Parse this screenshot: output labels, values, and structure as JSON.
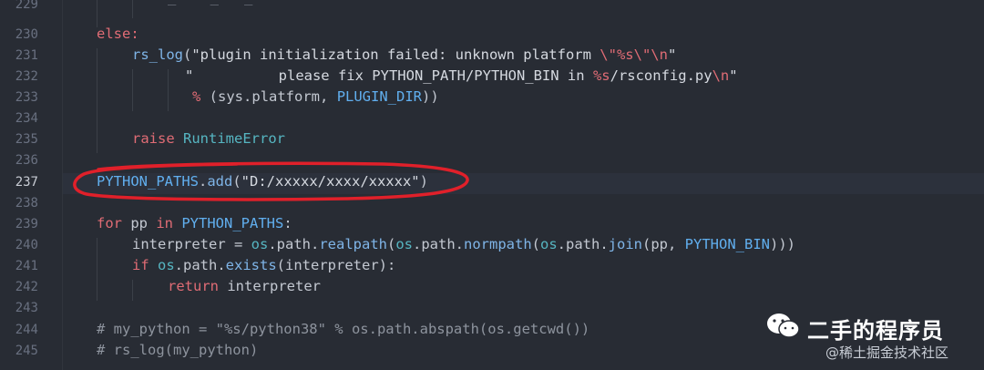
{
  "editor": {
    "lines": [
      {
        "n": "229",
        "active": false
      },
      {
        "n": "230",
        "active": false
      },
      {
        "n": "231",
        "active": false
      },
      {
        "n": "232",
        "active": false
      },
      {
        "n": "233",
        "active": false
      },
      {
        "n": "234",
        "active": false
      },
      {
        "n": "235",
        "active": false
      },
      {
        "n": "236",
        "active": false
      },
      {
        "n": "237",
        "active": true
      },
      {
        "n": "238",
        "active": false
      },
      {
        "n": "239",
        "active": false
      },
      {
        "n": "240",
        "active": false
      },
      {
        "n": "241",
        "active": false
      },
      {
        "n": "242",
        "active": false
      },
      {
        "n": "243",
        "active": false
      },
      {
        "n": "244",
        "active": false
      },
      {
        "n": "245",
        "active": false
      }
    ],
    "code": {
      "l230": {
        "else": "else:"
      },
      "l231": {
        "func": "rs_log",
        "open": "(",
        "str1": "\"plugin initialization failed: unknown platform ",
        "esc1": "\\\"",
        "fmt": "%s",
        "esc2": "\\\"",
        "esc3": "\\n",
        "str1end": "\""
      },
      "l232": {
        "str2": "\"          please fix PYTHON_PATH/PYTHON_BIN in ",
        "fmt": "%s",
        "str2b": "/rsconfig.py",
        "esc": "\\n",
        "str2end": "\""
      },
      "l233": {
        "pct": "%",
        "open": " (",
        "sys": "sys",
        "dot": ".",
        "platform": "platform",
        "comma": ", ",
        "plugin": "PLUGIN_DIR",
        "close": "))"
      },
      "l235": {
        "raise": "raise",
        "exc": "RuntimeError"
      },
      "l237": {
        "var": "PYTHON_PATHS",
        "dot": ".",
        "method": "add",
        "open": "(",
        "str": "\"D:/xxxxx/xxxx/xxxxx\"",
        "close": ")"
      },
      "l239": {
        "for": "for",
        "pp": " pp ",
        "in": "in",
        "var": " PYTHON_PATHS",
        "colon": ":"
      },
      "l240": {
        "interp": "interpreter",
        "eq": " = ",
        "os1": "os",
        "path1": ".path.",
        "realpath": "realpath",
        "p1": "(",
        "os2": "os",
        "path2": ".path.",
        "normpath": "normpath",
        "p2": "(",
        "os3": "os",
        "path3": ".path.",
        "join": "join",
        "p3": "(pp, ",
        "bin": "PYTHON_BIN",
        "close": ")))"
      },
      "l241": {
        "if": "if",
        "os": " os",
        "path": ".path.",
        "exists": "exists",
        "args": "(interpreter)",
        "colon": ":"
      },
      "l242": {
        "return": "return",
        "val": " interpreter"
      },
      "l244": {
        "comment": "# my_python = \"%s/python38\" % os.path.abspath(os.getcwd())"
      },
      "l245": {
        "comment": "# rs_log(my_python)"
      }
    }
  },
  "watermark": {
    "title": "二手的程序员",
    "subtitle": "@稀土掘金技术社区",
    "icon": "wechat-icon"
  },
  "colors": {
    "background": "#282c34",
    "highlight_circle": "#e0202a",
    "keyword": "#e06c75",
    "constant": "#61afef"
  }
}
